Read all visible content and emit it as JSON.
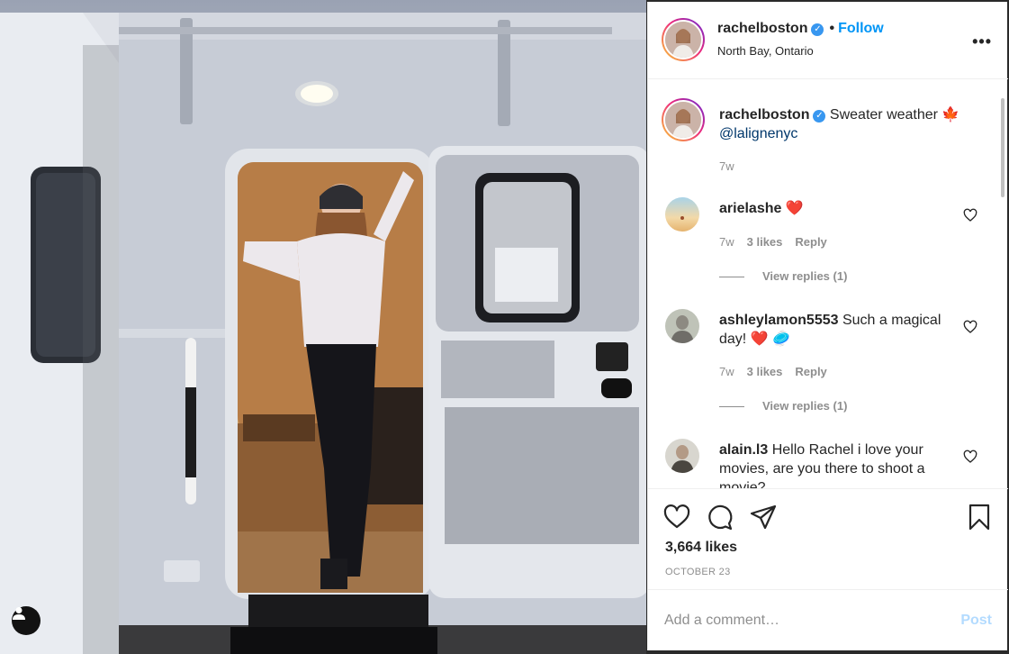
{
  "post": {
    "username": "rachelboston",
    "follow_label": "Follow",
    "dot": "•",
    "location": "North Bay, Ontario",
    "more_label": "•••"
  },
  "caption": {
    "username": "rachelboston",
    "text": "Sweater weather 🍁",
    "mention": "@lalignenyc",
    "time": "7w"
  },
  "comments": [
    {
      "username": "arielashe",
      "text": "❤️",
      "time": "7w",
      "likes": "3 likes",
      "reply_label": "Reply",
      "view_replies": "View replies (1)"
    },
    {
      "username": "ashleylamon5553",
      "text": "Such a magical day! ❤️ 🥏",
      "time": "7w",
      "likes": "3 likes",
      "reply_label": "Reply",
      "view_replies": "View replies (1)"
    },
    {
      "username": "alain.l3",
      "text": "Hello Rachel i love your movies, are you there to shoot a movie?"
    }
  ],
  "stats": {
    "likes": "3,664 likes",
    "date": "OCTOBER 23"
  },
  "add_comment": {
    "placeholder": "Add a comment…",
    "post_label": "Post"
  },
  "icons": {
    "user_tag": "person-icon",
    "like": "heart-icon",
    "comment": "comment-icon",
    "share": "paper-plane-icon",
    "save": "bookmark-icon",
    "verified": "verified-badge-icon"
  },
  "colors": {
    "accent": "#0095f6",
    "post_disabled": "#b3dbff",
    "muted": "#8e8e8e",
    "verified": "#3897f0"
  }
}
